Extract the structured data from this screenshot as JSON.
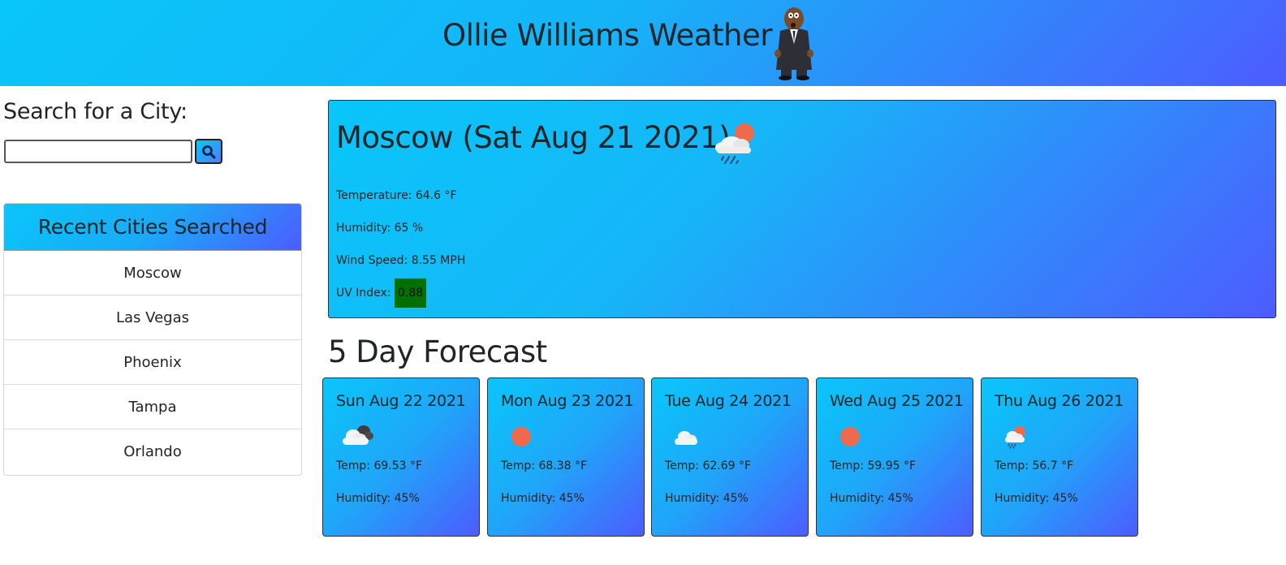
{
  "header": {
    "title": "Ollie Williams Weather",
    "mascot_icon": "cartoon-man-in-suit"
  },
  "search": {
    "label": "Search for a City:",
    "value": "",
    "button_icon": "magnifier-icon"
  },
  "recent": {
    "heading": "Recent Cities Searched",
    "cities": [
      "Moscow",
      "Las Vegas",
      "Phoenix",
      "Tampa",
      "Orlando"
    ]
  },
  "current": {
    "title": "Moscow (Sat Aug 21 2021)",
    "icon": "rain-cloud-with-sun",
    "temperature": "Temperature: 64.6 °F",
    "humidity": "Humidity: 65 %",
    "wind": "Wind Speed: 8.55 MPH",
    "uv_label": "UV Index:",
    "uv_value": "0.88",
    "uv_color": "#007000"
  },
  "forecast": {
    "heading": "5 Day Forecast",
    "days": [
      {
        "date": "Sun Aug 22 2021",
        "icon": "broken-clouds",
        "temp": "Temp: 69.53 °F",
        "humidity": "Humidity: 45%"
      },
      {
        "date": "Mon Aug 23 2021",
        "icon": "clear-sun",
        "temp": "Temp: 68.38 °F",
        "humidity": "Humidity: 45%"
      },
      {
        "date": "Tue Aug 24 2021",
        "icon": "cloud",
        "temp": "Temp: 62.69 °F",
        "humidity": "Humidity: 45%"
      },
      {
        "date": "Wed Aug 25 2021",
        "icon": "clear-sun",
        "temp": "Temp: 59.95 °F",
        "humidity": "Humidity: 45%"
      },
      {
        "date": "Thu Aug 26 2021",
        "icon": "rain-cloud-with-sun",
        "temp": "Temp: 56.7 °F",
        "humidity": "Humidity: 45%"
      }
    ]
  },
  "colors": {
    "gradient_start": "#09c6f9",
    "gradient_end": "#4d5cff",
    "sun": "#ee6a4c"
  }
}
